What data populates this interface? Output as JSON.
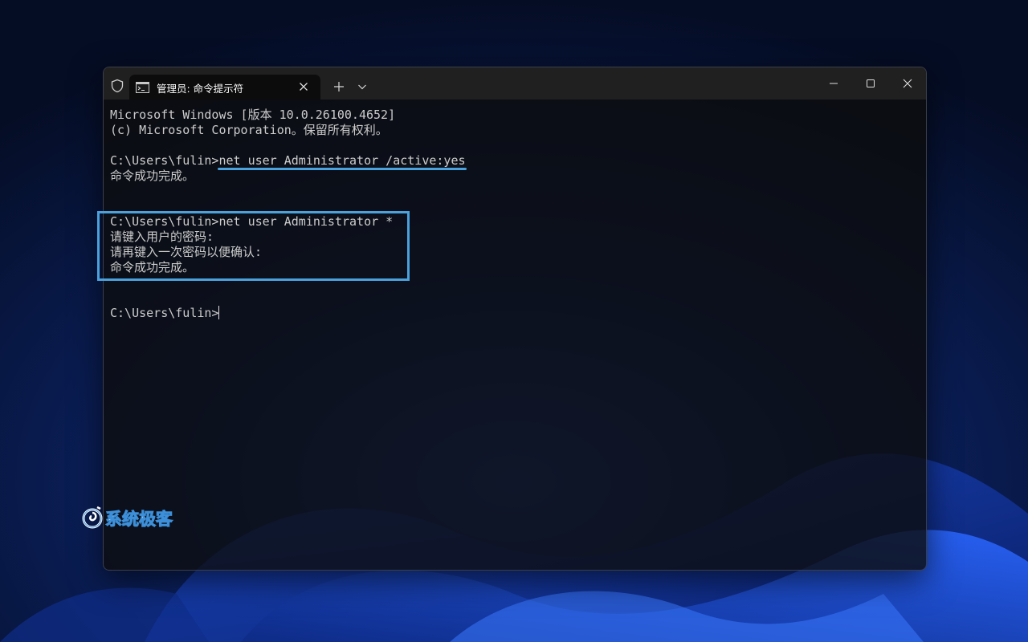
{
  "tab": {
    "title": "管理员: 命令提示符",
    "icon": "cmd-icon"
  },
  "titlebar_icons": {
    "shield": "shield-icon",
    "new_tab": "plus-icon",
    "dropdown": "chevron-down-icon",
    "minimize": "minimize-icon",
    "maximize": "maximize-icon",
    "close": "close-icon"
  },
  "terminal": {
    "lines": [
      "Microsoft Windows [版本 10.0.26100.4652]",
      "(c) Microsoft Corporation。保留所有权利。",
      "",
      "C:\\Users\\fulin>net user Administrator /active:yes",
      "命令成功完成。",
      "",
      "",
      "C:\\Users\\fulin>net user Administrator *",
      "请键入用户的密码:",
      "请再键入一次密码以便确认:",
      "命令成功完成。",
      "",
      "",
      "C:\\Users\\fulin>"
    ]
  },
  "annotation": {
    "color": "#4aa1dc"
  },
  "watermark": {
    "text": "系统极客"
  }
}
